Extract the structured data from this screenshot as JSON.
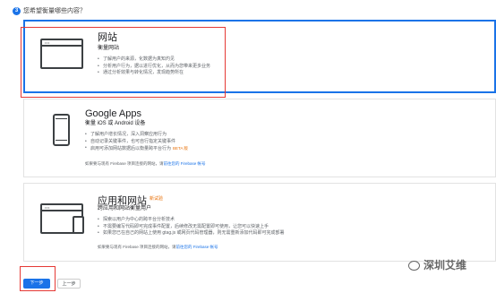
{
  "step": {
    "number": "3",
    "question": "您希望衡量哪些内容？"
  },
  "cards": {
    "web": {
      "title": "网站",
      "subtitle": "衡量网站",
      "bullets": [
        "了解用户的来源，化数据为真知灼见",
        "分析用户行为，据以进行优化，从而为您带来更多业务",
        "通过分析效果与转化情况，发现趋势所在"
      ]
    },
    "apps": {
      "title": "Google Apps",
      "subtitle": "衡量 iOS 或 Android 设备",
      "bullets": [
        "了解用户增长情况，深入洞察应用行为",
        "自动记录关键事件，也可自行指定关键事件",
        "启用可添加网站数据后以衡量跨平台行为"
      ],
      "beta": "BETA 版",
      "note": "如果要与现有 Firebase 项目连接的网站，请",
      "note_link": "前往您的 Firebase 帐号"
    },
    "both": {
      "title": "应用和网站",
      "badge": "新试验",
      "subtitle": "跨应用和网站衡量用户",
      "bullets": [
        "探索以用户为中心的跨平台分析技术",
        "不需要编写代码即可完成事件配置，后续修改无需配置即可使用，让您可以快速上手",
        "如果您已在自己的网站上使用 gtag.js 或网页代码管理器，则无需重新添加代码即可完成部署"
      ],
      "note": "如果要与现有 Firebase 项目连接的网站，请",
      "note_link": "前往您的 Firebase 帐号"
    }
  },
  "buttons": {
    "next": "下一步",
    "prev": "上一步"
  },
  "watermark": "深圳艾维",
  "colors": {
    "accent": "#1a73e8",
    "highlight": "#e53935"
  }
}
